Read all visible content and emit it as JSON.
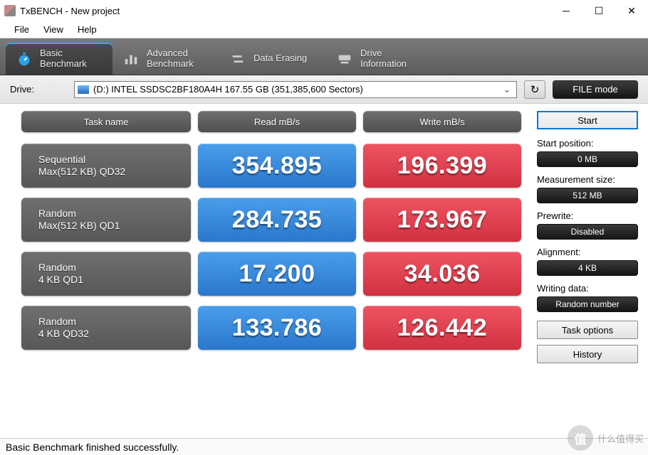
{
  "window": {
    "title": "TxBENCH - New project"
  },
  "menu": {
    "file": "File",
    "view": "View",
    "help": "Help"
  },
  "tabs": {
    "basic": {
      "line1": "Basic",
      "line2": "Benchmark"
    },
    "advanced": {
      "line1": "Advanced",
      "line2": "Benchmark"
    },
    "erase": {
      "line1": "Data Erasing"
    },
    "drive": {
      "line1": "Drive",
      "line2": "Information"
    }
  },
  "drive": {
    "label": "Drive:",
    "value": "(D:) INTEL SSDSC2BF180A4H  167.55 GB (351,385,600 Sectors)",
    "mode": "FILE mode"
  },
  "headers": {
    "task": "Task name",
    "read": "Read mB/s",
    "write": "Write mB/s"
  },
  "rows": [
    {
      "name1": "Sequential",
      "name2": "Max(512 KB) QD32",
      "read": "354.895",
      "write": "196.399"
    },
    {
      "name1": "Random",
      "name2": "Max(512 KB) QD1",
      "read": "284.735",
      "write": "173.967"
    },
    {
      "name1": "Random",
      "name2": "4 KB QD1",
      "read": "17.200",
      "write": "34.036"
    },
    {
      "name1": "Random",
      "name2": "4 KB QD32",
      "read": "133.786",
      "write": "126.442"
    }
  ],
  "chart_data": {
    "type": "table",
    "title": "Basic Benchmark",
    "columns": [
      "Task name",
      "Read mB/s",
      "Write mB/s"
    ],
    "series": [
      {
        "name": "Read mB/s",
        "values": [
          354.895,
          284.735,
          17.2,
          133.786
        ]
      },
      {
        "name": "Write mB/s",
        "values": [
          196.399,
          173.967,
          34.036,
          126.442
        ]
      }
    ],
    "categories": [
      "Sequential Max(512 KB) QD32",
      "Random Max(512 KB) QD1",
      "Random 4 KB QD1",
      "Random 4 KB QD32"
    ]
  },
  "side": {
    "start": "Start",
    "start_pos_label": "Start position:",
    "start_pos_val": "0 MB",
    "meas_label": "Measurement size:",
    "meas_val": "512 MB",
    "prewrite_label": "Prewrite:",
    "prewrite_val": "Disabled",
    "align_label": "Alignment:",
    "align_val": "4 KB",
    "writing_label": "Writing data:",
    "writing_val": "Random number",
    "task_options": "Task options",
    "history": "History"
  },
  "status": "Basic Benchmark finished successfully.",
  "watermark": {
    "text": "什么值得买",
    "badge": "值"
  }
}
